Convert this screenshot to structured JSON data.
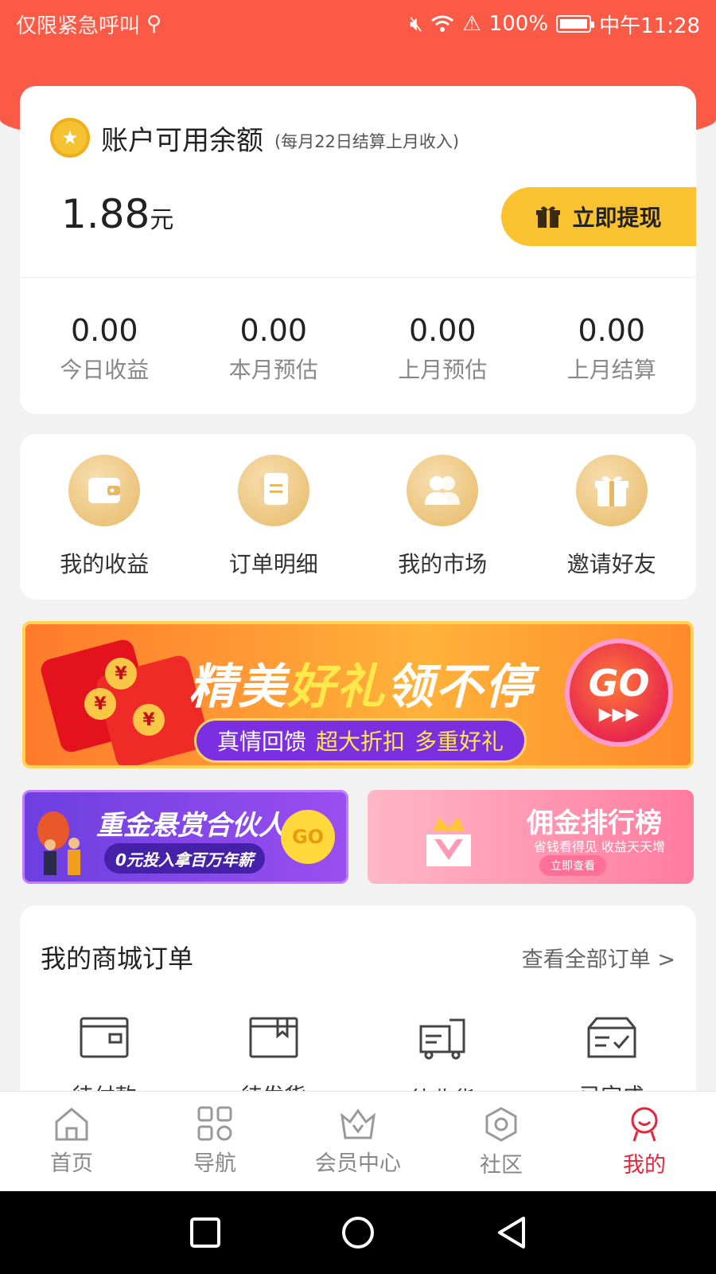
{
  "status_bar": {
    "carrier": "仅限紧急呼叫",
    "battery": "100%",
    "time": "中午11:28"
  },
  "balance": {
    "label": "账户可用余额",
    "note": "(每月22日结算上月收入)",
    "amount": "1.88",
    "unit": "元",
    "withdraw_label": "立即提现",
    "stats": [
      {
        "value": "0.00",
        "label": "今日收益"
      },
      {
        "value": "0.00",
        "label": "本月预估"
      },
      {
        "value": "0.00",
        "label": "上月预估"
      },
      {
        "value": "0.00",
        "label": "上月结算"
      }
    ]
  },
  "menu": [
    {
      "label": "我的收益",
      "icon": "wallet-icon"
    },
    {
      "label": "订单明细",
      "icon": "document-icon"
    },
    {
      "label": "我的市场",
      "icon": "people-icon"
    },
    {
      "label": "邀请好友",
      "icon": "gift-icon"
    }
  ],
  "banner_main": {
    "title_part1": "精美",
    "title_highlight": "好礼",
    "title_part2": "领不停",
    "sub_1": "真情回馈",
    "sub_2": "超大折扣",
    "sub_3": "多重好礼",
    "go": "GO",
    "yuan_symbol": "¥"
  },
  "banner_left": {
    "title": "重金悬赏合伙人",
    "sub": "0元投入拿百万年薪",
    "go": "GO"
  },
  "banner_right": {
    "title": "佣金排行榜",
    "sub": "省钱看得见 收益天天增",
    "button": "立即查看"
  },
  "orders": {
    "title": "我的商城订单",
    "link": "查看全部订单 >",
    "items": [
      {
        "label": "待付款",
        "icon": "wallet-outline-icon"
      },
      {
        "label": "待发货",
        "icon": "box-icon"
      },
      {
        "label": "待收货",
        "icon": "truck-icon"
      },
      {
        "label": "已完成",
        "icon": "check-box-icon"
      }
    ]
  },
  "tabs": [
    {
      "label": "首页",
      "icon": "home-icon"
    },
    {
      "label": "导航",
      "icon": "grid-icon"
    },
    {
      "label": "会员中心",
      "icon": "crown-icon"
    },
    {
      "label": "社区",
      "icon": "hexagon-icon"
    },
    {
      "label": "我的",
      "icon": "profile-icon",
      "active": true
    }
  ],
  "colors": {
    "brand_red": "#fa5a46",
    "gold": "#f9c22e",
    "active_tab": "#e8233a"
  }
}
